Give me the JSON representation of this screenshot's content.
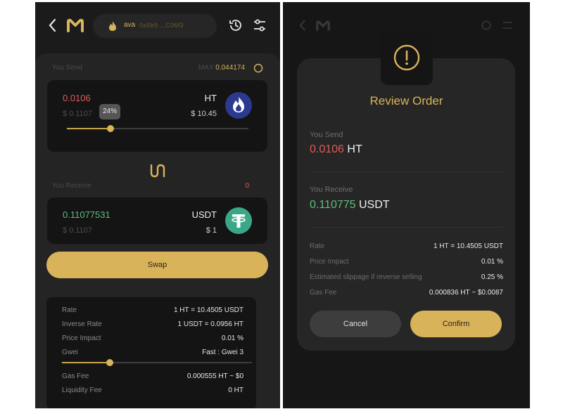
{
  "left": {
    "wallet": {
      "name": "ava",
      "address": "0x6b9....C06f3"
    },
    "send": {
      "label": "You Send",
      "max_label": "MAX",
      "max_value": "0.044174",
      "amount": "0.0106",
      "usd_value": "$ 0.1107",
      "percent_label": "24%",
      "percent": 24,
      "token": "HT",
      "token_usd": "$ 10.45"
    },
    "receive": {
      "label": "You Receive",
      "count": "0",
      "amount": "0.11077531",
      "usd_value": "$ 0.1107",
      "token": "USDT",
      "token_usd": "$ 1"
    },
    "swap_label": "Swap",
    "info": {
      "rows": [
        {
          "label": "Rate",
          "value": "1 HT = 10.4505 USDT"
        },
        {
          "label": "Inverse Rate",
          "value": "1 USDT = 0.0956 HT"
        },
        {
          "label": "Price Impact",
          "value": "0.01 %"
        },
        {
          "label": "Gwei",
          "value": "Fast : Gwei 3"
        }
      ],
      "gwei_level": 0.25,
      "rows2": [
        {
          "label": "Gas Fee",
          "value": "0.000555 HT ~ $0"
        },
        {
          "label": "Liquidity Fee",
          "value": "0 HT"
        }
      ]
    }
  },
  "modal": {
    "title": "Review Order",
    "send_label": "You Send",
    "send_amount": "0.0106",
    "send_token": "HT",
    "receive_label": "You Receive",
    "receive_amount": "0.110775",
    "receive_token": "USDT",
    "details": [
      {
        "label": "Rate",
        "value": "1 HT = 10.4505 USDT"
      },
      {
        "label": "Price Impact",
        "value": "0.01 %"
      },
      {
        "label": "Estimated slippage if reverse selling",
        "value": "0.25 %"
      },
      {
        "label": "Gas Fee",
        "value": "0.000836 HT ~ $0.0087"
      }
    ],
    "cancel_label": "Cancel",
    "confirm_label": "Confirm"
  },
  "colors": {
    "accent": "#d8b45a",
    "send_red": "#e05a5a",
    "receive_green": "#5fbf7a",
    "ht_blue": "#2b3a8e",
    "usdt_teal": "#3aa888"
  }
}
